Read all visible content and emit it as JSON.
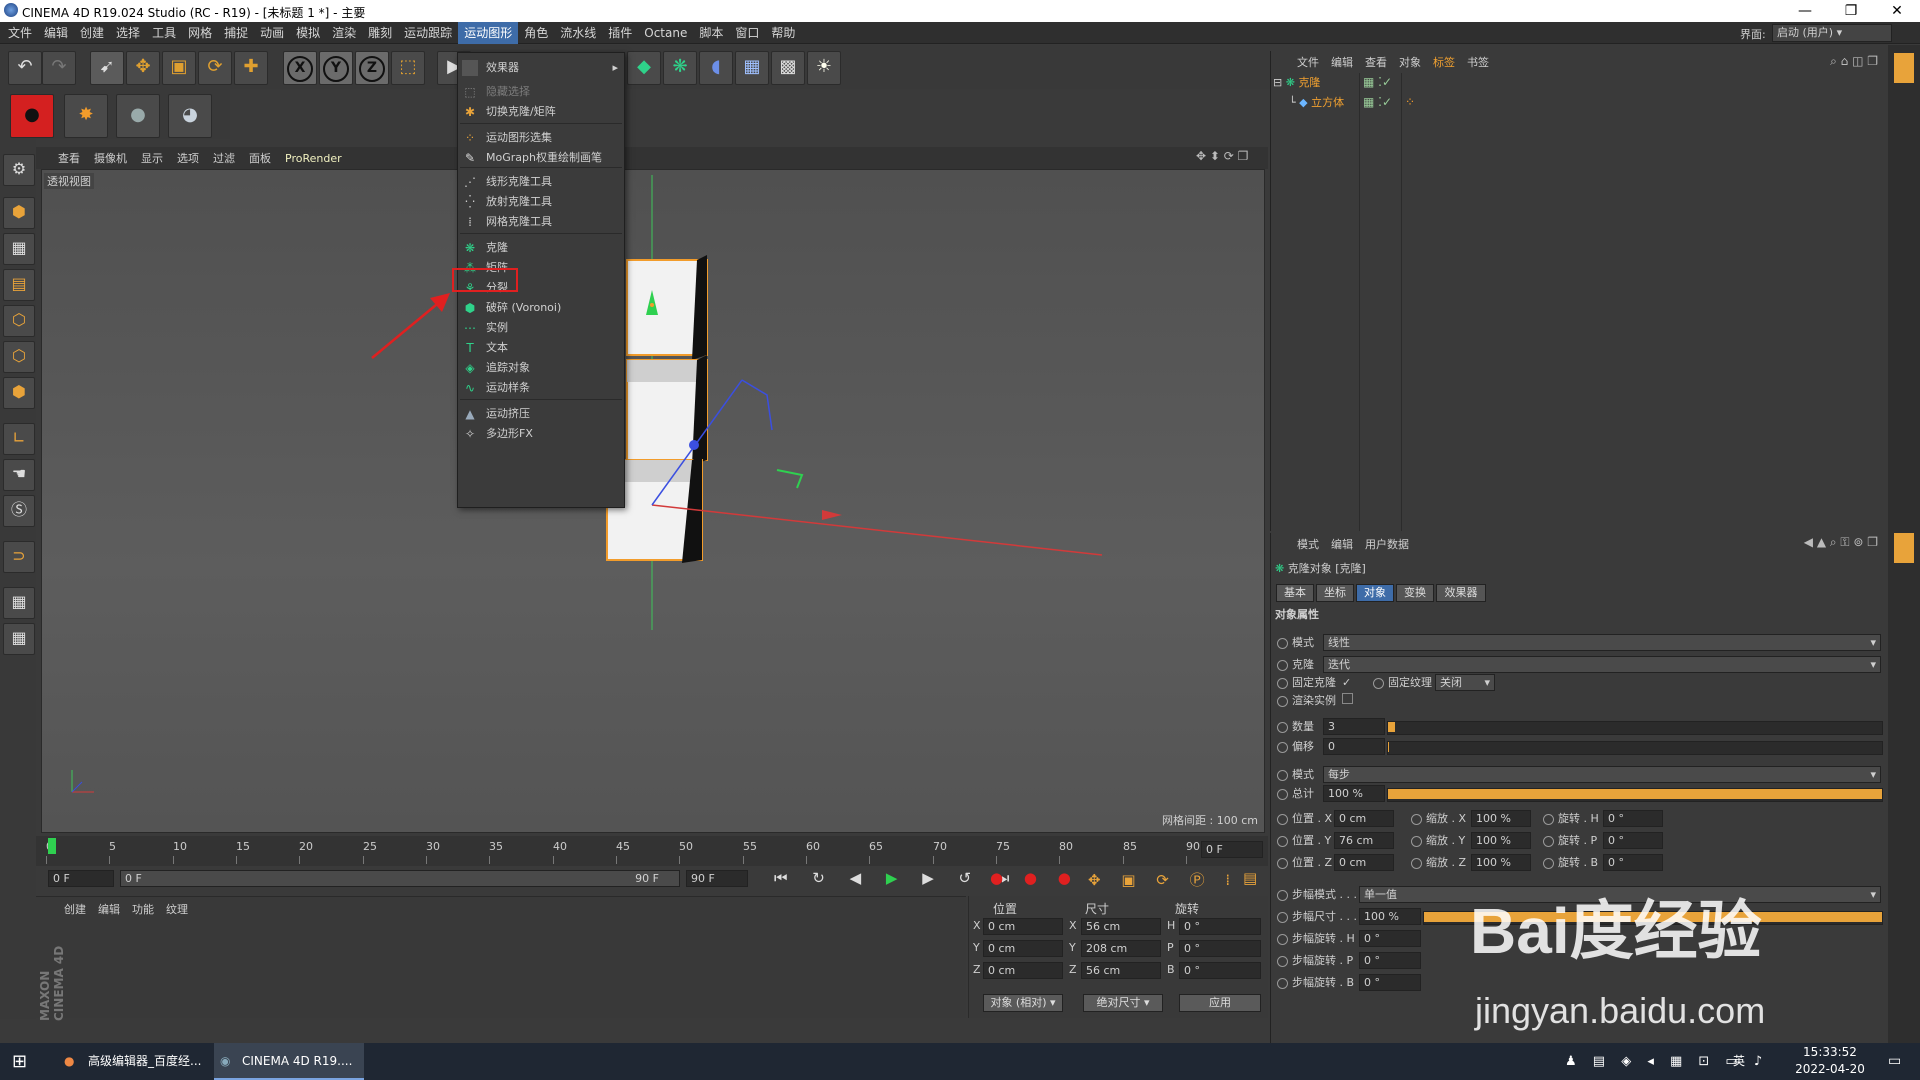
{
  "window": {
    "title": "CINEMA 4D R19.024 Studio (RC - R19) - [未标题 1 *] - 主要",
    "layout_label": "界面:",
    "layout_value": "启动 (用户)"
  },
  "menu": [
    "文件",
    "编辑",
    "创建",
    "选择",
    "工具",
    "网格",
    "捕捉",
    "动画",
    "模拟",
    "渲染",
    "雕刻",
    "运动跟踪",
    "运动图形",
    "角色",
    "流水线",
    "插件",
    "Octane",
    "脚本",
    "窗口",
    "帮助"
  ],
  "active_menu": "运动图形",
  "toolbar": {
    "xyz": [
      "X",
      "Y",
      "Z"
    ]
  },
  "viewport": {
    "menu": [
      "查看",
      "摄像机",
      "显示",
      "选项",
      "过滤",
      "面板",
      "ProRender"
    ],
    "name": "透视视图",
    "grid": "网格间距 : 100 cm"
  },
  "timeline": {
    "ticks": [
      "0",
      "5",
      "10",
      "15",
      "20",
      "25",
      "30",
      "35",
      "40",
      "45",
      "50",
      "55",
      "60",
      "65",
      "70",
      "75",
      "80",
      "85",
      "90"
    ],
    "frame_field": "0 F",
    "start": "0 F",
    "range_start": "0 F",
    "range_end": "90 F",
    "end": "90 F"
  },
  "material_panel": {
    "menu": [
      "创建",
      "编辑",
      "功能",
      "纹理"
    ],
    "brand": "MAXON CINEMA 4D"
  },
  "coord_panel": {
    "headers": [
      "位置",
      "尺寸",
      "旋转"
    ],
    "rows": [
      {
        "axis": "X",
        "pos": "0 cm",
        "size_axis": "X",
        "size": "56 cm",
        "rot_axis": "H",
        "rot": "0 °"
      },
      {
        "axis": "Y",
        "pos": "0 cm",
        "size_axis": "Y",
        "size": "208 cm",
        "rot_axis": "P",
        "rot": "0 °"
      },
      {
        "axis": "Z",
        "pos": "0 cm",
        "size_axis": "Z",
        "size": "56 cm",
        "rot_axis": "B",
        "rot": "0 °"
      }
    ],
    "mode1": "对象 (相对)",
    "mode2": "绝对尺寸",
    "apply": "应用"
  },
  "object_manager": {
    "menu": [
      "文件",
      "编辑",
      "查看",
      "对象",
      "标签",
      "书签"
    ],
    "objects": [
      {
        "name": "克隆"
      },
      {
        "name": "立方体"
      }
    ]
  },
  "attr_manager": {
    "menu": [
      "模式",
      "编辑",
      "用户数据"
    ],
    "title": "克隆对象 [克隆]",
    "tabs": [
      "基本",
      "坐标",
      "对象",
      "变换",
      "效果器"
    ],
    "active_tab": "对象",
    "section": "对象属性",
    "mode_label": "模式",
    "mode_value": "线性",
    "clone_label": "克隆",
    "clone_value": "迭代",
    "fix_clone": "固定克隆",
    "fix_tex": "固定纹理",
    "fix_tex_value": "关闭",
    "render_inst": "渲染实例",
    "count_label": "数量",
    "count_value": "3",
    "offset_label": "偏移",
    "offset_value": "0",
    "mode2_label": "模式",
    "mode2_value": "每步",
    "total_label": "总计",
    "total_value": "100 %",
    "pos": [
      {
        "l": "位置 . X",
        "v": "0 cm"
      },
      {
        "l": "位置 . Y",
        "v": "76 cm"
      },
      {
        "l": "位置 . Z",
        "v": "0 cm"
      }
    ],
    "scale": [
      {
        "l": "缩放 . X",
        "v": "100 %"
      },
      {
        "l": "缩放 . Y",
        "v": "100 %"
      },
      {
        "l": "缩放 . Z",
        "v": "100 %"
      }
    ],
    "rot": [
      {
        "l": "旋转 . H",
        "v": "0 °"
      },
      {
        "l": "旋转 . P",
        "v": "0 °"
      },
      {
        "l": "旋转 . B",
        "v": "0 °"
      }
    ],
    "step_mode_label": "步幅模式 . . .",
    "step_mode_value": "单一值",
    "step_size_label": "步幅尺寸 . . .",
    "step_size_value": "100 %",
    "step_rot": [
      {
        "l": "步幅旋转 . H",
        "v": "0 °"
      },
      {
        "l": "步幅旋转 . P",
        "v": "0 °"
      },
      {
        "l": "步幅旋转 . B",
        "v": "0 °"
      }
    ]
  },
  "dropdown": {
    "effector": "效果器",
    "items": [
      {
        "label": "隐藏选择",
        "dim": true,
        "icon": "⬚"
      },
      {
        "label": "切换克隆/矩阵",
        "icon": "✱"
      },
      {
        "label": "运动图形选集",
        "icon": "⁘"
      },
      {
        "label": "MoGraph权重绘制画笔",
        "icon": "✎"
      },
      {
        "label": "线形克隆工具",
        "icon": "⋰"
      },
      {
        "label": "放射克隆工具",
        "icon": "⁛"
      },
      {
        "label": "网格克隆工具",
        "icon": "⁞"
      },
      {
        "label": "克隆",
        "icon": "❋"
      },
      {
        "label": "矩阵",
        "icon": "⁂"
      },
      {
        "label": "分裂",
        "icon": "⚘"
      },
      {
        "label": "破碎 (Voronoi)",
        "icon": "⬢"
      },
      {
        "label": "实例",
        "icon": "⋯"
      },
      {
        "label": "文本",
        "icon": "T"
      },
      {
        "label": "追踪对象",
        "icon": "◈"
      },
      {
        "label": "运动样条",
        "icon": "∿"
      },
      {
        "label": "运动挤压",
        "icon": "▲"
      },
      {
        "label": "多边形FX",
        "icon": "✧"
      }
    ]
  },
  "taskbar": {
    "app1": "高级编辑器_百度经...",
    "app2": "CINEMA 4D R19....",
    "ime": "英",
    "time": "15:33:52",
    "date": "2022-04-20"
  },
  "watermark": {
    "brand": "Bai度经验",
    "url": "jingyan.baidu.com"
  },
  "colors": {
    "accent": "#3e6ca8",
    "highlight_box": "#e02020",
    "arrow": "#e02020"
  }
}
